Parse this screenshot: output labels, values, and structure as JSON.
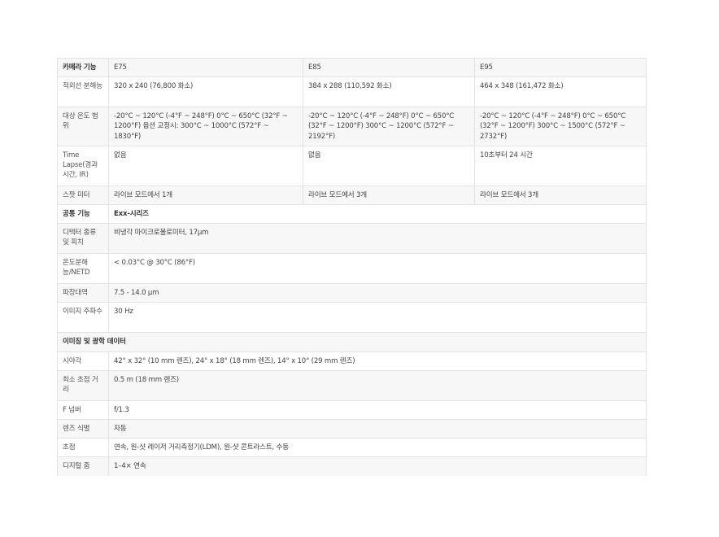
{
  "header": {
    "feature": "카메라 기능",
    "models": [
      "E75",
      "E85",
      "E95"
    ]
  },
  "model_rows": [
    {
      "label": "적외선 분해능",
      "values": [
        "320 x 240 (76,800 화소)",
        "384 x 288 (110,592 화소)",
        "464 x 348 (161,472 화소)"
      ]
    },
    {
      "label": "대상 온도 범위",
      "values": [
        "-20°C ~ 120°C (-4°F ~ 248°F) 0°C ~ 650°C (32°F ~ 1200°F) 옵션 교정시: 300°C ~ 1000°C (572°F ~ 1830°F)",
        "-20°C ~ 120°C (-4°F ~ 248°F) 0°C ~ 650°C (32°F ~ 1200°F) 300°C ~ 1200°C (572°F ~ 2192°F)",
        "-20°C ~ 120°C (-4°F ~ 248°F) 0°C ~ 650°C (32°F ~ 1200°F) 300°C ~ 1500°C (572°F ~ 2732°F)"
      ]
    },
    {
      "label": "Time Lapse(경과 시간, IR)",
      "values": [
        "없음",
        "없음",
        "10초부터 24 시간"
      ]
    },
    {
      "label": "스팟 미터",
      "values": [
        "라이브 모드에서 1개",
        "라이브 모드에서 3개",
        "라이브 모드에서 3개"
      ]
    }
  ],
  "common": {
    "label": "공통 기능",
    "series": "Exx-시리즈",
    "rows": [
      {
        "label": "디텍터 종류 및 피치",
        "value": "비냉각 마이크로볼로미터, 17µm"
      },
      {
        "label": "온도분해능/NETD",
        "value": "< 0.03°C @ 30°C (86°F)"
      },
      {
        "label": "파장대역",
        "value": "7.5 - 14.0 µm"
      },
      {
        "label": "이미지 주파수",
        "value": "30 Hz"
      }
    ]
  },
  "imaging": {
    "label": "이미징 및 광학 데이터",
    "rows": [
      {
        "label": "시야각",
        "value": "42° x 32° (10 mm 렌즈), 24° x 18° (18 mm 렌즈), 14° x 10° (29 mm 렌즈)"
      },
      {
        "label": "최소 초점 거리",
        "value": "0.5 m (18 mm 렌즈)"
      },
      {
        "label": "F 넘버",
        "value": "f/1.3"
      },
      {
        "label": "렌즈 식별",
        "value": "자동"
      },
      {
        "label": "초점",
        "value": "연속, 원-샷 레이저 거리측정기(LDM), 원-샷 콘트라스트, 수동"
      },
      {
        "label": "디지털 줌",
        "value": "1–4× 연속"
      }
    ]
  }
}
